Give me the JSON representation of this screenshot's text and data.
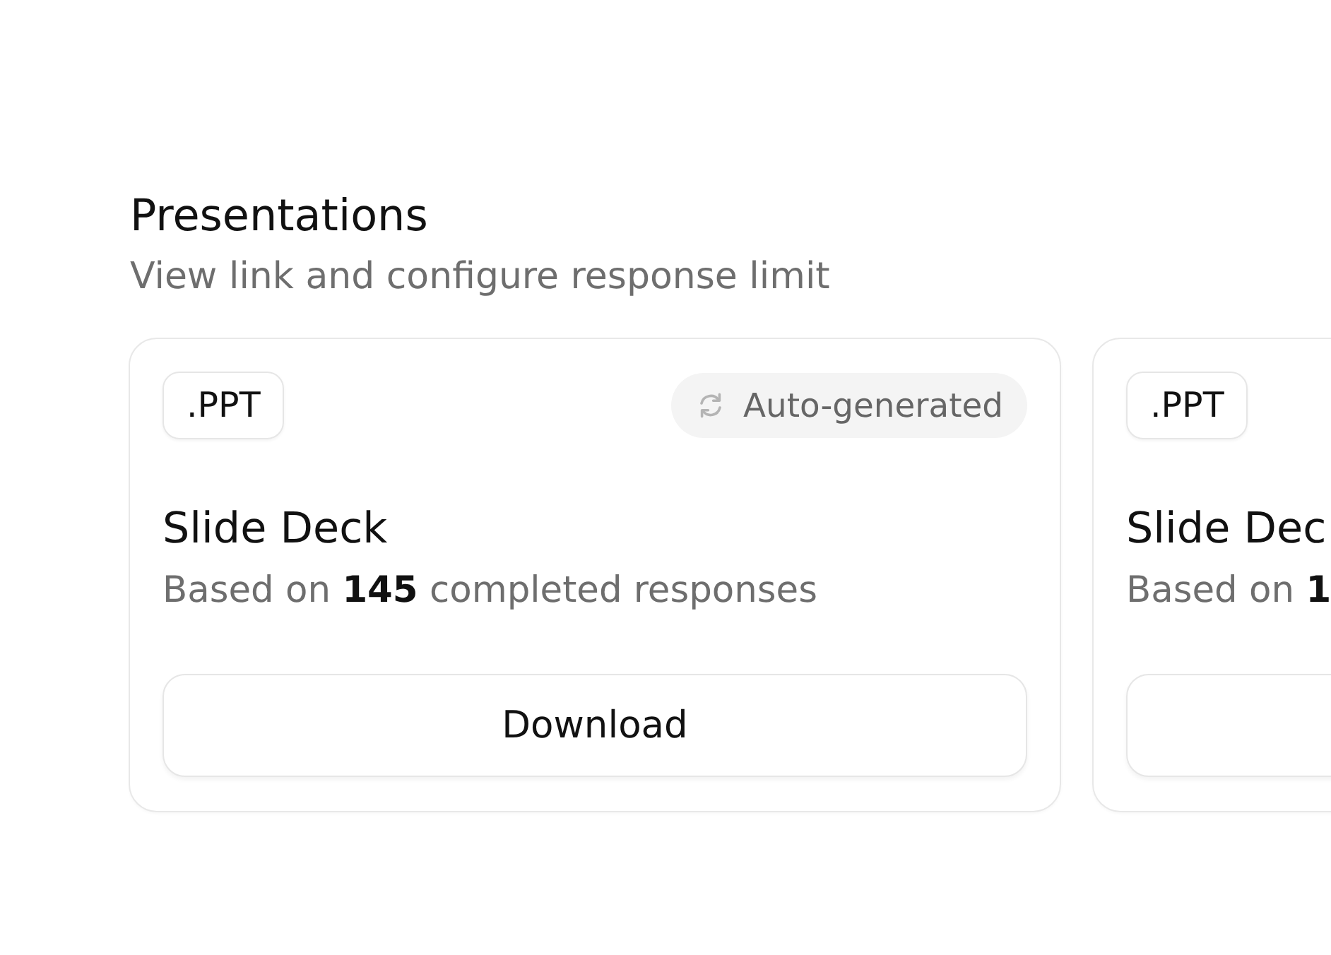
{
  "section": {
    "title": "Presentations",
    "subtitle": "View link and configure response limit"
  },
  "cards": [
    {
      "format": ".PPT",
      "badge": {
        "label": "Auto-generated"
      },
      "title": "Slide Deck",
      "description": "Based on **145** completed responses",
      "button": "Download"
    },
    {
      "format": ".PPT",
      "title": "Slide Dec",
      "description": "Based on **1**"
    }
  ]
}
